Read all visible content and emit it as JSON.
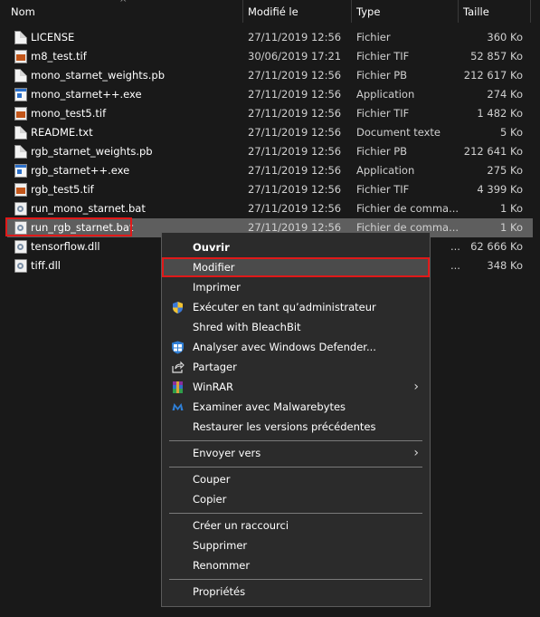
{
  "columns": {
    "name": "Nom",
    "modified": "Modifié le",
    "type": "Type",
    "size": "Taille"
  },
  "files": [
    {
      "name": "LICENSE",
      "date": "27/11/2019 12:56",
      "type": "Fichier",
      "size": "360 Ko",
      "icon": "document-icon"
    },
    {
      "name": "m8_test.tif",
      "date": "30/06/2019 17:21",
      "type": "Fichier TIF",
      "size": "52 857 Ko",
      "icon": "image-file-icon"
    },
    {
      "name": "mono_starnet_weights.pb",
      "date": "27/11/2019 12:56",
      "type": "Fichier PB",
      "size": "212 617 Ko",
      "icon": "document-icon"
    },
    {
      "name": "mono_starnet++.exe",
      "date": "27/11/2019 12:56",
      "type": "Application",
      "size": "274 Ko",
      "icon": "executable-icon"
    },
    {
      "name": "mono_test5.tif",
      "date": "27/11/2019 12:56",
      "type": "Fichier TIF",
      "size": "1 482 Ko",
      "icon": "image-file-icon"
    },
    {
      "name": "README.txt",
      "date": "27/11/2019 12:56",
      "type": "Document texte",
      "size": "5 Ko",
      "icon": "document-icon"
    },
    {
      "name": "rgb_starnet_weights.pb",
      "date": "27/11/2019 12:56",
      "type": "Fichier PB",
      "size": "212 641 Ko",
      "icon": "document-icon"
    },
    {
      "name": "rgb_starnet++.exe",
      "date": "27/11/2019 12:56",
      "type": "Application",
      "size": "275 Ko",
      "icon": "executable-icon"
    },
    {
      "name": "rgb_test5.tif",
      "date": "27/11/2019 12:56",
      "type": "Fichier TIF",
      "size": "4 399 Ko",
      "icon": "image-file-icon"
    },
    {
      "name": "run_mono_starnet.bat",
      "date": "27/11/2019 12:56",
      "type": "Fichier de comma...",
      "size": "1 Ko",
      "icon": "batch-file-icon"
    },
    {
      "name": "run_rgb_starnet.bat",
      "date": "27/11/2019 12:56",
      "type": "Fichier de comma...",
      "size": "1 Ko",
      "icon": "batch-file-icon",
      "selected": true
    },
    {
      "name": "tensorflow.dll",
      "date": "",
      "type": "...pp...",
      "size": "62 666 Ko",
      "icon": "dll-file-icon"
    },
    {
      "name": "tiff.dll",
      "date": "",
      "type": "...pp...",
      "size": "348 Ko",
      "icon": "dll-file-icon"
    }
  ],
  "context_menu": {
    "open": "Ouvrir",
    "edit": "Modifier",
    "print": "Imprimer",
    "run_as_admin": "Exécuter en tant qu’administrateur",
    "shred": "Shred with BleachBit",
    "defender": "Analyser avec Windows Defender...",
    "share": "Partager",
    "winrar": "WinRAR",
    "malwarebytes": "Examiner avec Malwarebytes",
    "restore": "Restaurer les versions précédentes",
    "send_to": "Envoyer vers",
    "cut": "Couper",
    "copy": "Copier",
    "shortcut": "Créer un raccourci",
    "delete": "Supprimer",
    "rename": "Renommer",
    "properties": "Propriétés"
  },
  "colors": {
    "background": "#191919",
    "selected_row": "#5e5e5e",
    "menu_bg": "#2b2b2b",
    "highlight_border": "#e01919"
  }
}
